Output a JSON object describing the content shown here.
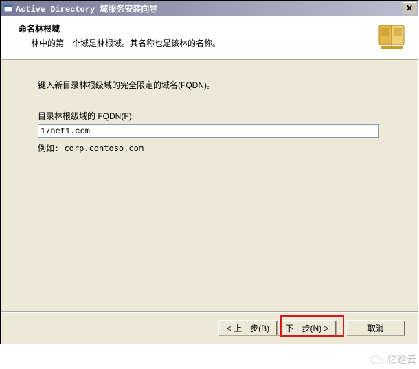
{
  "titlebar": {
    "title": "Active Directory 域服务安装向导"
  },
  "header": {
    "title": "命名林根域",
    "subtitle": "林中的第一个域是林根域。其名称也是该林的名称。"
  },
  "content": {
    "instruction": "键入新目录林根级域的完全限定的域名(FQDN)。",
    "field_label": "目录林根级域的 FQDN(F):",
    "fqdn_value": "17net1.com",
    "example": "例如: corp.contoso.com"
  },
  "buttons": {
    "back": "< 上一步(B)",
    "next": "下一步(N) >",
    "cancel": "取消"
  },
  "watermark": {
    "text": "亿速云"
  }
}
